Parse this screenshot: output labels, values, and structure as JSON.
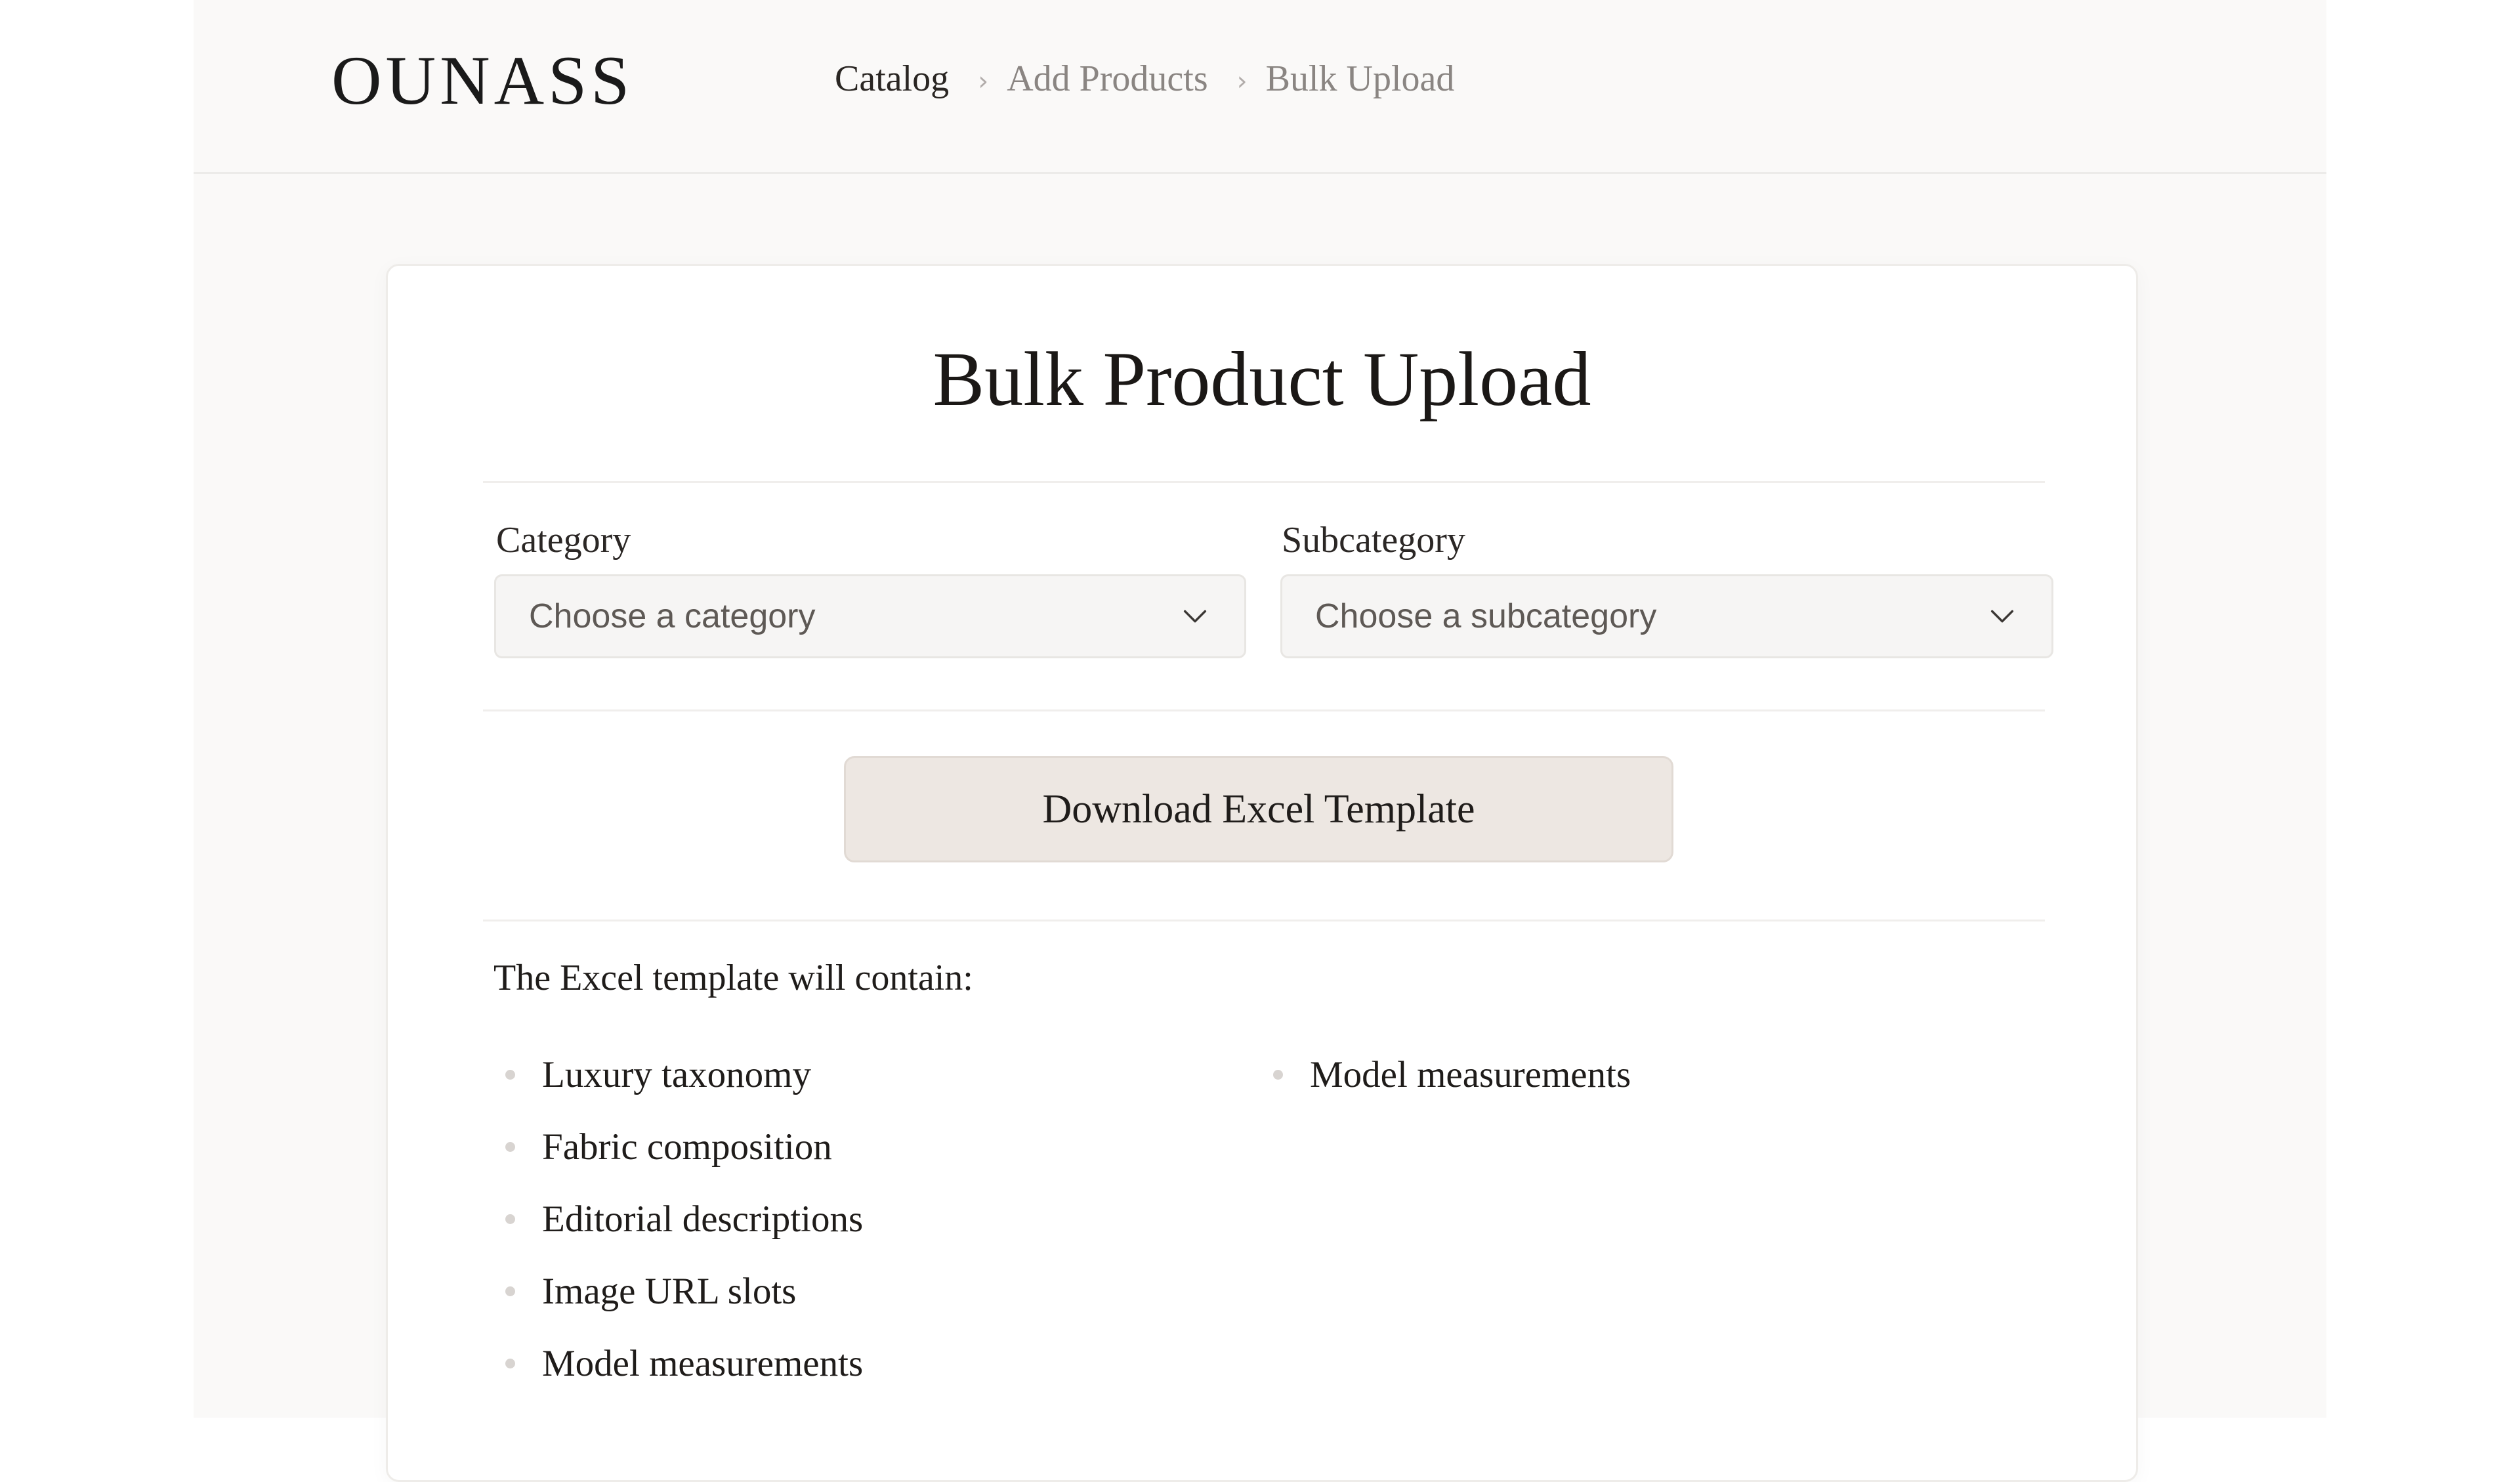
{
  "header": {
    "logo": "OUNASS",
    "breadcrumb": {
      "items": [
        "Catalog",
        "Add Products",
        "Bulk Upload"
      ],
      "separator": "›"
    }
  },
  "card": {
    "title": "Bulk Product Upload",
    "category": {
      "label": "Category",
      "placeholder": "Choose a category"
    },
    "subcategory": {
      "label": "Subcategory",
      "placeholder": "Choose a subcategory"
    },
    "download_button": "Download Excel Template",
    "contains_intro": "The Excel template will contain:",
    "features_left": [
      "Luxury taxonomy",
      "Fabric composition",
      "Editorial descriptions",
      "Image URL slots",
      "Model measurements"
    ],
    "features_right": [
      "Model measurements"
    ]
  },
  "colors": {
    "page_background": "#faf9f8",
    "card_background": "#ffffff",
    "button_background": "#ede7e2",
    "select_background": "#f6f5f4",
    "text_primary": "#1f1c1a",
    "text_muted": "#8a8582"
  },
  "icons": {
    "breadcrumb_separator": "chevron-right-icon",
    "select_toggle": "chevron-down-icon",
    "list_marker": "bullet-dot-icon"
  }
}
